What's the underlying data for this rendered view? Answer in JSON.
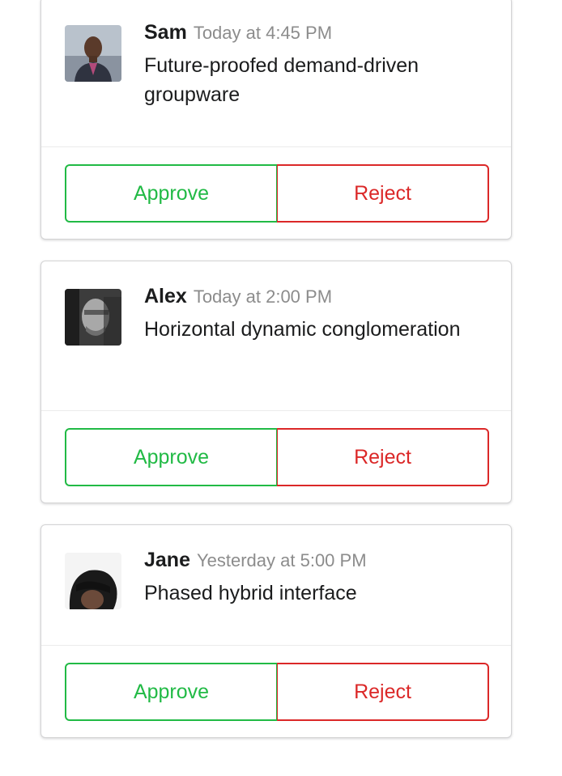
{
  "cards": [
    {
      "author": "Sam",
      "date": "Today at 4:45 PM",
      "description": "Future-proofed demand-driven groupware",
      "approve_label": "Approve",
      "reject_label": "Reject"
    },
    {
      "author": "Alex",
      "date": "Today at 2:00 PM",
      "description": "Horizontal dynamic conglomeration",
      "approve_label": "Approve",
      "reject_label": "Reject"
    },
    {
      "author": "Jane",
      "date": "Yesterday at 5:00 PM",
      "description": "Phased hybrid interface",
      "approve_label": "Approve",
      "reject_label": "Reject"
    }
  ],
  "colors": {
    "approve": "#21ba45",
    "reject": "#db2828",
    "muted_text": "#8c8c8c",
    "text": "#1b1c1d"
  }
}
